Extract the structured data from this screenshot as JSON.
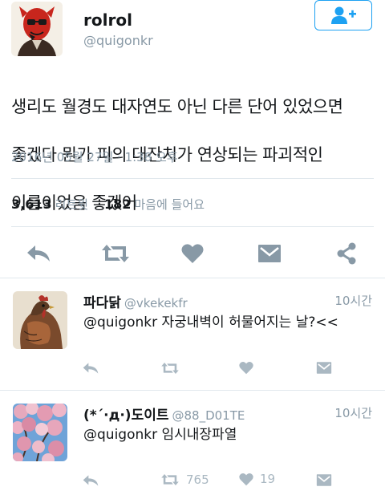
{
  "colors": {
    "twitter_blue": "#1da1f2",
    "icon_gray": "#8899a6",
    "icon_light": "#aab8c2",
    "divider": "#e1e8ed"
  },
  "tweet": {
    "name": "rolrol",
    "handle": "@quigonkr",
    "text_lines": [
      "생리도 월경도 대자연도 아닌 다른 단어 있었으면",
      "좋겠다 뭔가 피의 대잔치가 연상되는 파괴적인",
      "이름이었음 좋겠어"
    ],
    "timestamp": "2016년 05월 27일 · 1:38 오후",
    "retweet_count": "3,613",
    "retweet_label": "리트윗",
    "like_count": "182",
    "like_label": "마음에 들어요",
    "icons": [
      "follow-icon",
      "reply-icon",
      "retweet-icon",
      "like-icon",
      "message-icon",
      "share-icon"
    ]
  },
  "replies": [
    {
      "name": "파다닭",
      "handle": "@vkekekfr",
      "time": "10시간",
      "text": "@quigonkr 자궁내벽이 허물어지는 날?<<",
      "retweets": "",
      "likes": ""
    },
    {
      "name": "(*´·д·)도이트",
      "handle": "@88_D01TE",
      "time": "10시간",
      "text": "@quigonkr 임시내장파열",
      "retweets": "765",
      "likes": "19"
    }
  ]
}
